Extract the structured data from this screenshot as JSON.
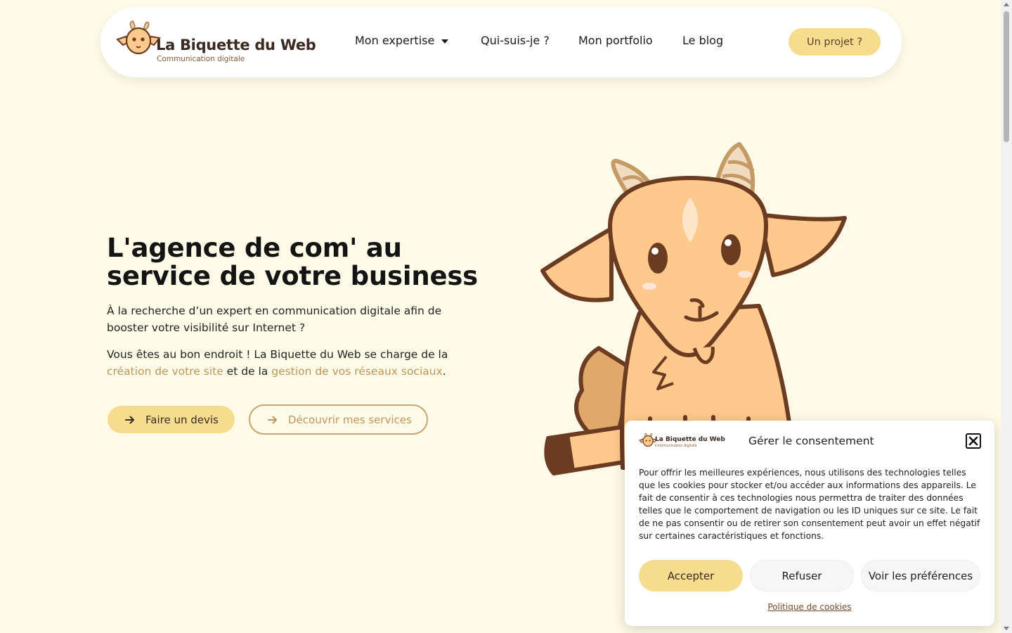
{
  "header": {
    "logo_name": "La Biquette du Web",
    "logo_tagline": "Communication digitale",
    "nav": [
      {
        "label": "Mon expertise"
      },
      {
        "label": "Qui-suis-je ?"
      },
      {
        "label": "Mon portfolio"
      },
      {
        "label": "Le blog"
      }
    ],
    "cta_label": "Un projet ?"
  },
  "hero": {
    "title_line1": "L'agence de com' au",
    "title_line2": "service de votre business",
    "para1": "À la recherche d’un expert en communication digitale afin de booster votre visibilité sur Internet ?",
    "para2_part1": "Vous êtes au bon endroit ! La Biquette du Web se charge de la ",
    "para2_link1": "création de votre site",
    "para2_part2": " et de la ",
    "para2_link2": "gestion de vos réseaux sociaux",
    "para2_part3": ".",
    "btn_devis": "Faire un devis",
    "btn_services": "Découvrir mes services"
  },
  "consent": {
    "logo_name": "La Biquette du Web",
    "logo_tagline": "Communication digitale",
    "title": "Gérer le consentement",
    "text": "Pour offrir les meilleures expériences, nous utilisons des technologies telles que les cookies pour stocker et/ou accéder aux informations des appareils. Le fait de consentir à ces technologies nous permettra de traiter des données telles que le comportement de navigation ou les ID uniques sur ce site. Le fait de ne pas consentir ou de retirer son consentement peut avoir un effet négatif sur certaines caractéristiques et fonctions.",
    "accept": "Accepter",
    "refuse": "Refuser",
    "preferences": "Voir les préférences",
    "policy": "Politique de cookies"
  },
  "colors": {
    "background": "#fefce8",
    "accent": "#f5dc8f",
    "link": "#c0955d",
    "goat_fur": "#fec98c",
    "goat_outline": "#6b3b22"
  },
  "icons": [
    "goat-logo-icon",
    "chevron-down-icon",
    "arrow-right-icon",
    "close-icon",
    "goat-illustration"
  ]
}
